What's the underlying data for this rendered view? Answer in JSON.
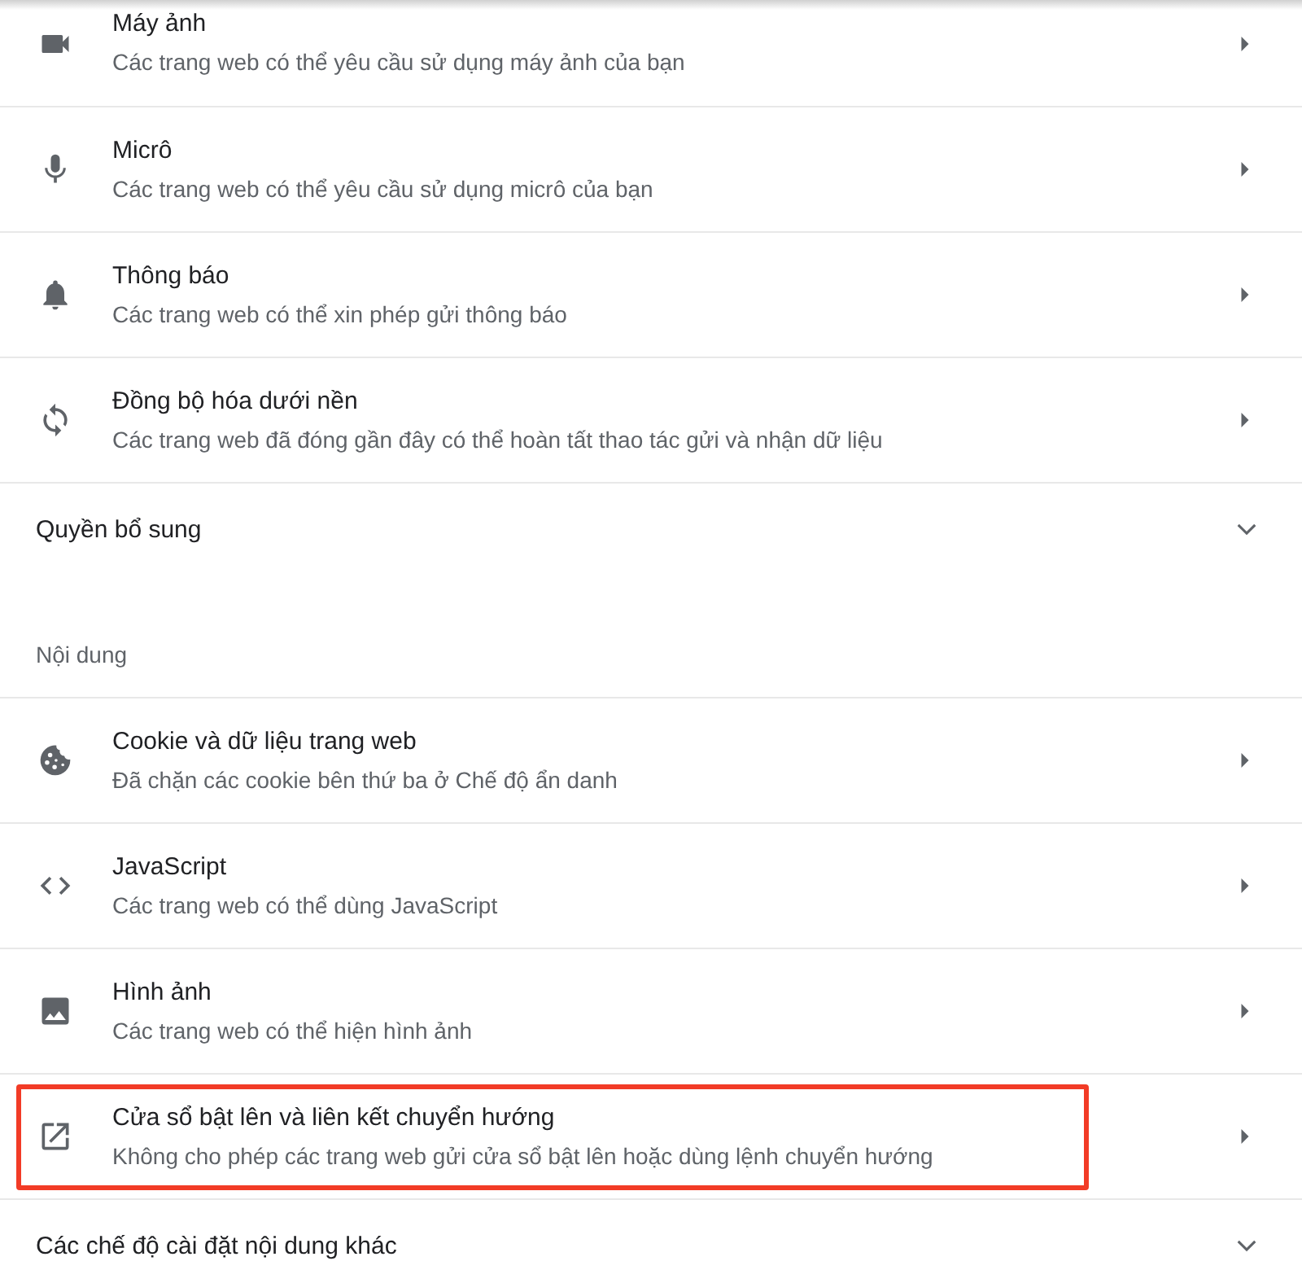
{
  "rows": [
    {
      "kind": "link",
      "title": "Máy ảnh",
      "subtitle": "Các trang web có thể yêu cầu sử dụng máy ảnh của bạn",
      "highlighted": false
    },
    {
      "kind": "link",
      "title": "Micrô",
      "subtitle": "Các trang web có thể yêu cầu sử dụng micrô của bạn",
      "highlighted": false
    },
    {
      "kind": "link",
      "title": "Thông báo",
      "subtitle": "Các trang web có thể xin phép gửi thông báo",
      "highlighted": false
    },
    {
      "kind": "link",
      "title": "Đồng bộ hóa dưới nền",
      "subtitle": "Các trang web đã đóng gần đây có thể hoàn tất thao tác gửi và nhận dữ liệu",
      "highlighted": false
    },
    {
      "kind": "expand",
      "title": "Quyền bổ sung"
    },
    {
      "kind": "header",
      "title": "Nội dung"
    },
    {
      "kind": "link",
      "title": "Cookie và dữ liệu trang web",
      "subtitle": "Đã chặn các cookie bên thứ ba ở Chế độ ẩn danh",
      "highlighted": false
    },
    {
      "kind": "link",
      "title": "JavaScript",
      "subtitle": "Các trang web có thể dùng JavaScript",
      "highlighted": false
    },
    {
      "kind": "link",
      "title": "Hình ảnh",
      "subtitle": "Các trang web có thể hiện hình ảnh",
      "highlighted": false
    },
    {
      "kind": "link",
      "title": "Cửa sổ bật lên và liên kết chuyển hướng",
      "subtitle": "Không cho phép các trang web gửi cửa sổ bật lên hoặc dùng lệnh chuyển hướng",
      "highlighted": true
    },
    {
      "kind": "expand",
      "title": "Các chế độ cài đặt nội dung khác"
    }
  ]
}
